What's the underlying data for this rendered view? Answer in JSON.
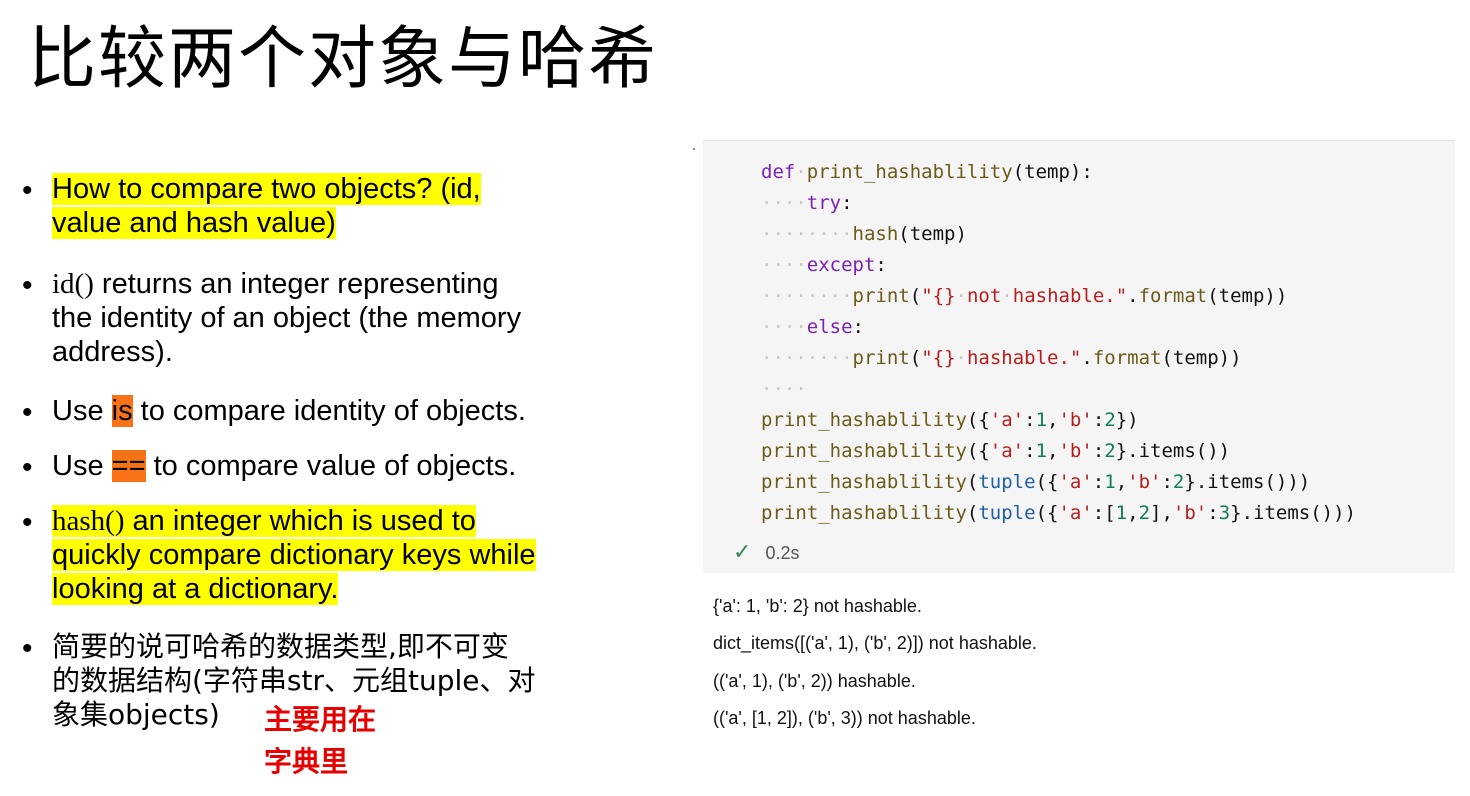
{
  "slide": {
    "title": "比较两个对象与哈希"
  },
  "bullets": [
    {
      "text_a": "How to compare two objects? (id,",
      "text_b": "value and hash value)"
    },
    {
      "fn": "id()",
      "rest": " returns an integer representing",
      "line2": "the identity of an object (the memory",
      "line3": "address)."
    },
    {
      "pre": "Use ",
      "op": "is",
      "post": " to compare identity of objects."
    },
    {
      "pre": "Use ",
      "op": "==",
      "post": " to compare value of objects."
    },
    {
      "fn": "hash()",
      "rest": " an integer which is used to",
      "line2": "quickly compare dictionary keys while",
      "line3": "looking at a dictionary."
    },
    {
      "line1": "简要的说可哈希的数据类型,即不可变",
      "line2": "的数据结构(字符串str、元组tuple、对",
      "line3": "象集objects)"
    }
  ],
  "note": {
    "line1": "主要用在",
    "line2": "字典里"
  },
  "code": {
    "lines": [
      "def print_hashablility(temp):",
      "try:",
      "hash(temp)",
      "except:",
      "print(\"{} not hashable.\".format(temp))",
      "else:",
      "print(\"{} hashable.\".format(temp))",
      "",
      "print_hashablility({'a':1,'b':2})",
      "print_hashablility({'a':1,'b':2}.items())",
      "print_hashablility(tuple({'a':1,'b':2}.items()))",
      "print_hashablility(tuple({'a':[1,2],'b':3}.items()))"
    ],
    "status_icon": "check-icon",
    "status_time": "0.2s"
  },
  "output": [
    "{'a': 1, 'b': 2} not hashable.",
    "dict_items([('a', 1), ('b', 2)]) not hashable.",
    "(('a', 1), ('b', 2)) hashable.",
    "(('a', [1, 2]), ('b', 3)) not hashable."
  ],
  "colors": {
    "highlight_yellow": "#ffff00",
    "highlight_orange": "#f97316",
    "note_red": "#e60000",
    "keyword_purple": "#7a21b8",
    "string_red": "#b81d1d",
    "number_green": "#0e7d59",
    "builtin_blue": "#1f5fa6"
  }
}
